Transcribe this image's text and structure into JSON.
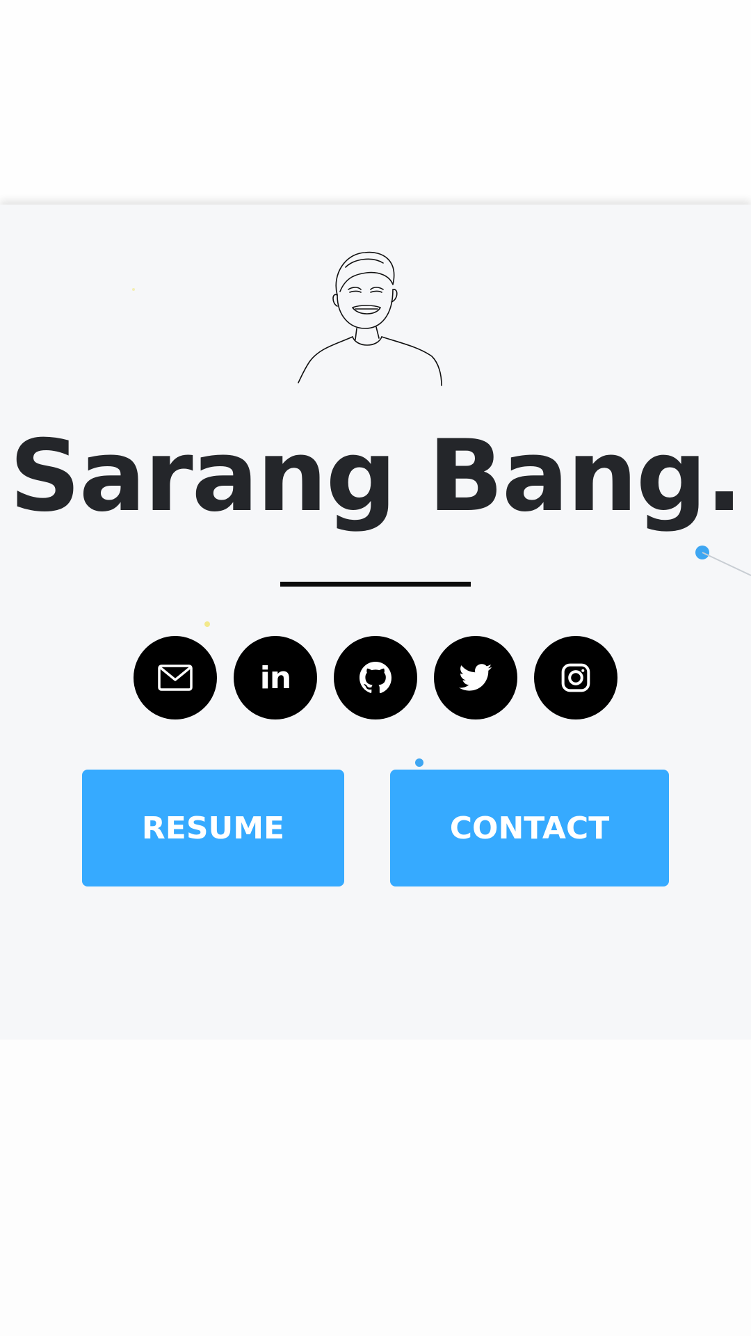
{
  "hero": {
    "name": "Sarang Bang.",
    "socials": [
      {
        "label": "",
        "icon": "mail-icon"
      },
      {
        "label": "in",
        "icon": "linkedin-icon"
      },
      {
        "label": "",
        "icon": "github-icon"
      },
      {
        "label": "",
        "icon": "twitter-icon"
      },
      {
        "label": "",
        "icon": "instagram-icon"
      }
    ],
    "buttons": {
      "resume": "RESUME",
      "contact": "CONTACT"
    }
  },
  "colors": {
    "accent": "#36aaff",
    "text": "#24262a",
    "hero_bg": "#f6f7f9",
    "icon_bg": "#000000"
  }
}
